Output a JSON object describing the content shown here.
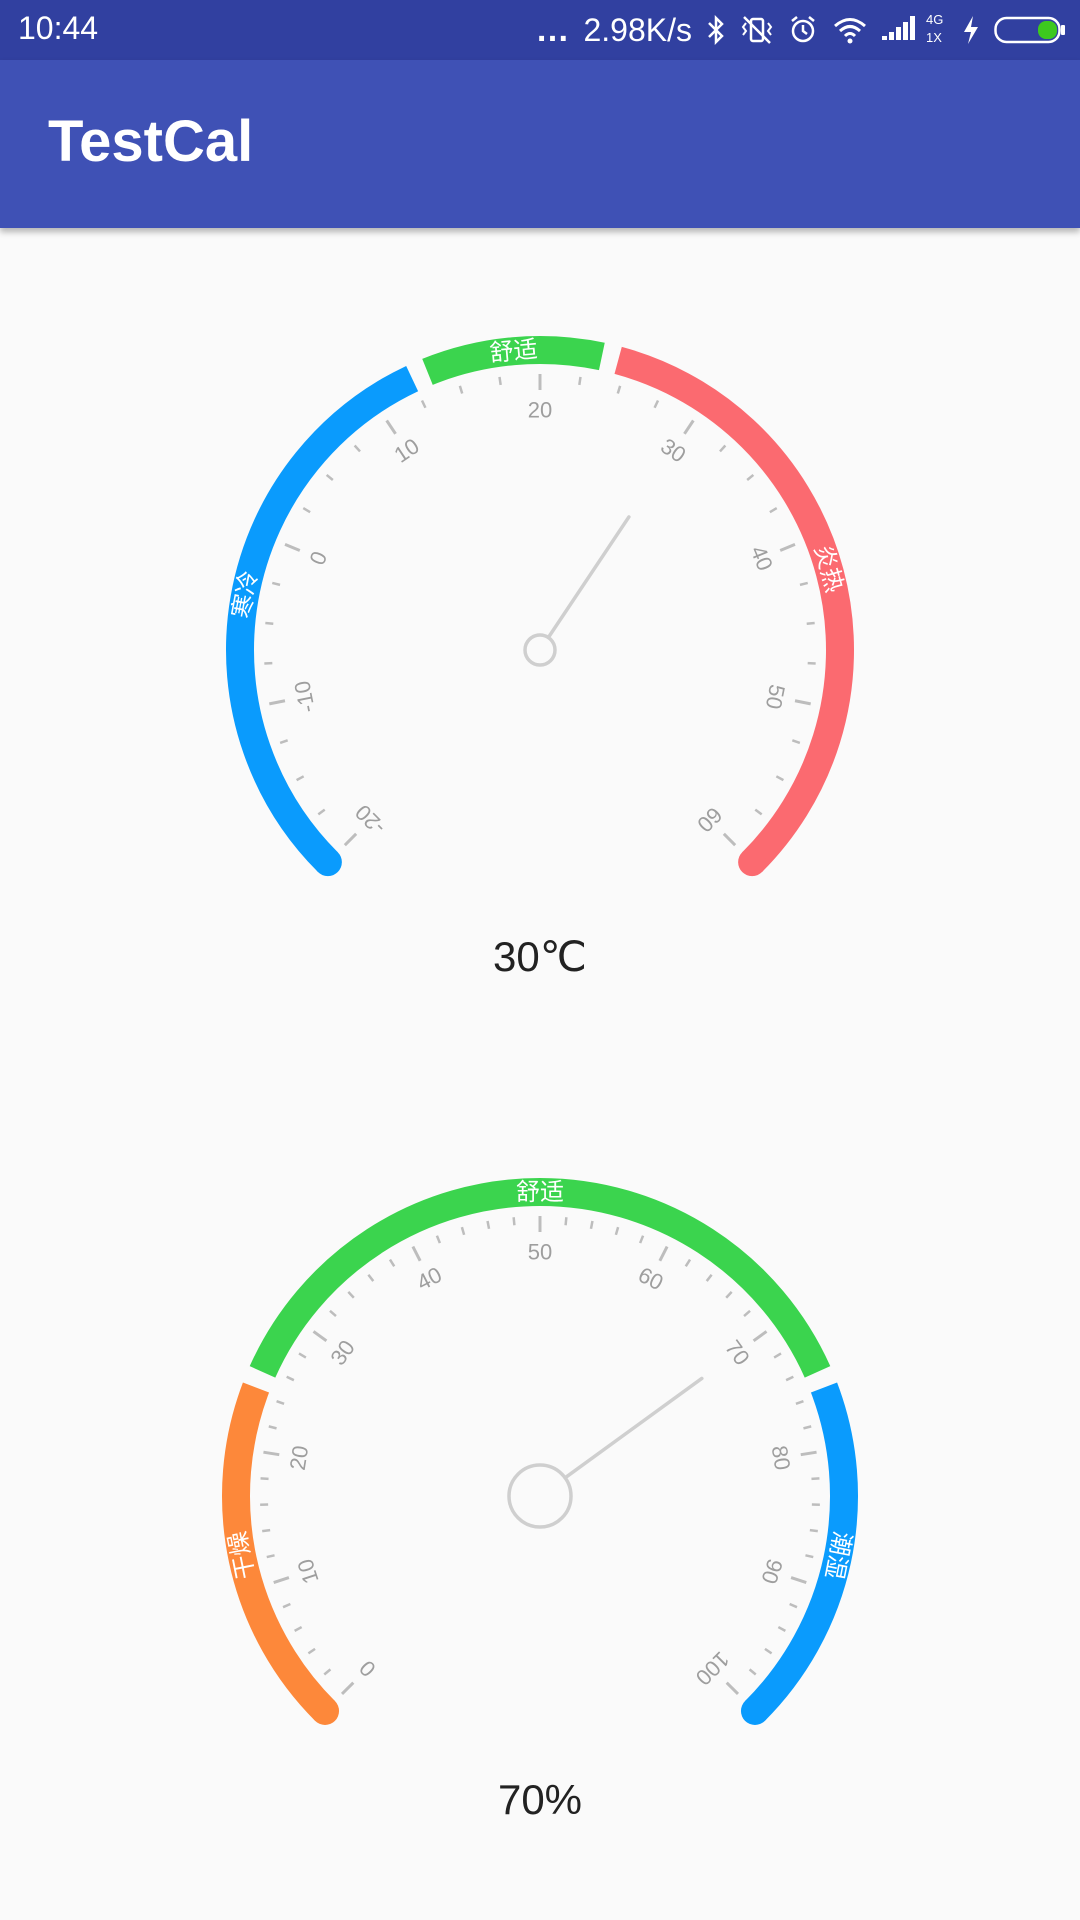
{
  "status_bar": {
    "time": "10:44",
    "more_icon": "…",
    "network_speed": "2.98K/s",
    "network_type": "4G",
    "sim_label": "1X",
    "icons": [
      "more-dots-icon",
      "bluetooth-icon",
      "vibrate-off-icon",
      "alarm-icon",
      "wifi-icon",
      "signal-icon",
      "charging-icon",
      "battery-icon"
    ],
    "battery_color": "#3dc91e"
  },
  "app_bar": {
    "title": "TestCal",
    "color": "#3f51b5"
  },
  "temperature_gauge": {
    "value": 30,
    "value_label": "30℃",
    "min": -20,
    "max": 60,
    "major_ticks": [
      "-20",
      "-10",
      "0",
      "10",
      "20",
      "30",
      "40",
      "50",
      "60"
    ],
    "zones": [
      {
        "label": "寒冷",
        "from": -20,
        "to": 13,
        "color": "#0a9bfd"
      },
      {
        "label": "舒适",
        "from": 13,
        "to": 24,
        "color": "#3bd44e"
      },
      {
        "label": "炎热",
        "from": 24,
        "to": 60,
        "color": "#fb6a70"
      }
    ]
  },
  "humidity_gauge": {
    "value": 70,
    "value_label": "70%",
    "min": 0,
    "max": 100,
    "major_ticks": [
      "0",
      "10",
      "20",
      "30",
      "40",
      "50",
      "60",
      "70",
      "80",
      "90",
      "100"
    ],
    "zones": [
      {
        "label": "干燥",
        "from": 0,
        "to": 25,
        "color": "#fd883a"
      },
      {
        "label": "舒适",
        "from": 25,
        "to": 75,
        "color": "#3bd44e"
      },
      {
        "label": "潮湿",
        "from": 75,
        "to": 100,
        "color": "#0a9bfd"
      }
    ]
  }
}
